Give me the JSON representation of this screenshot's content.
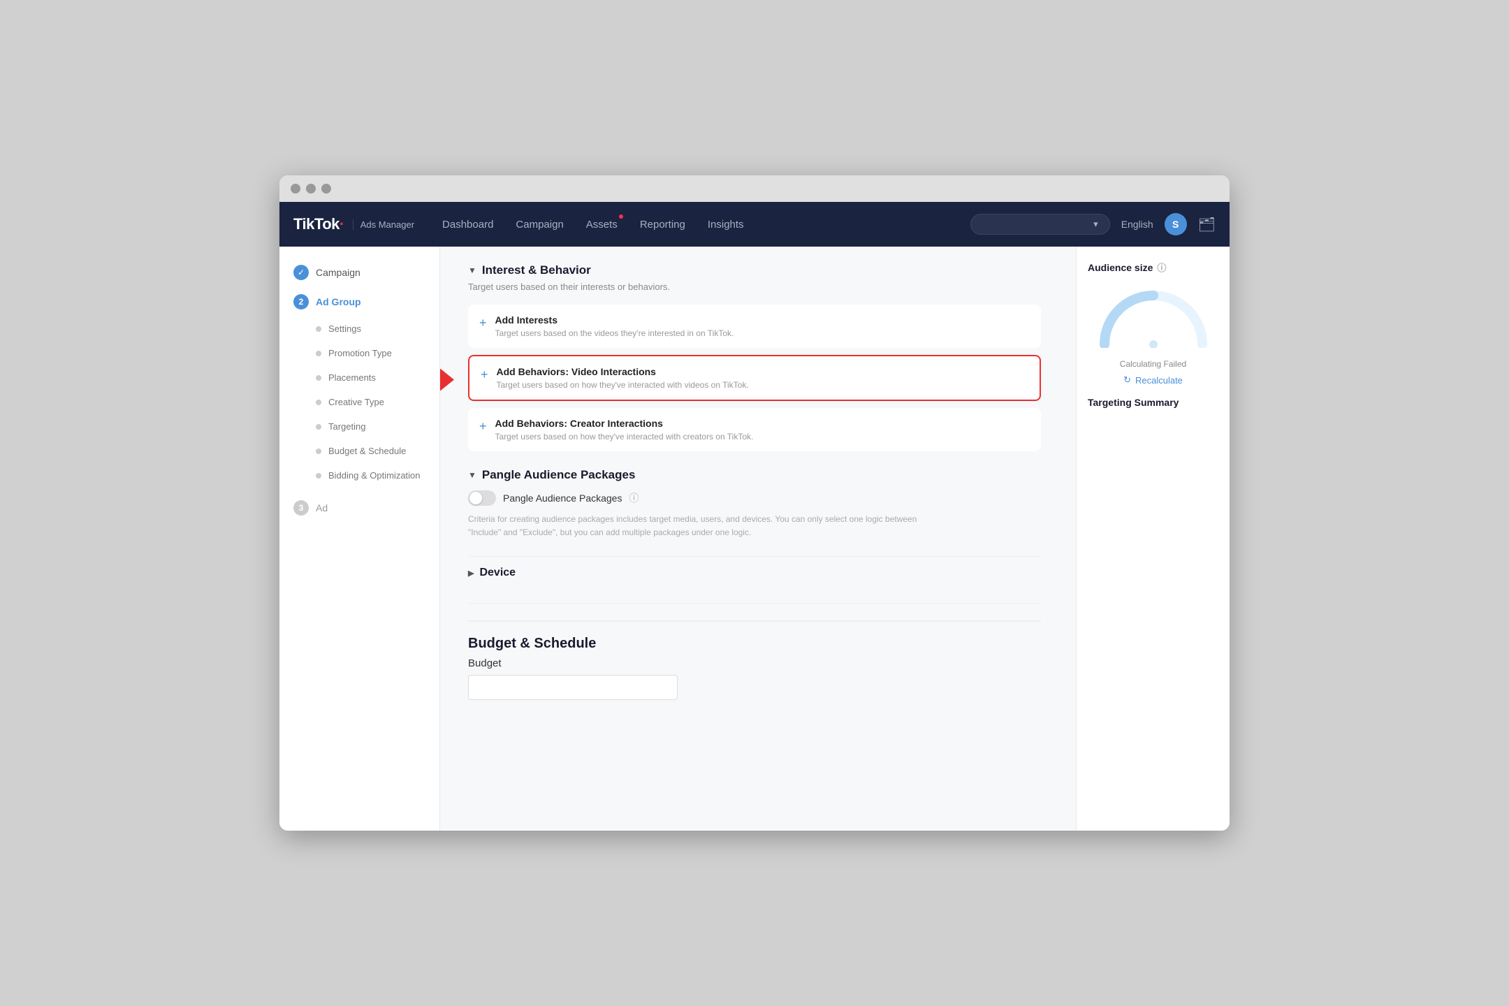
{
  "browser": {
    "title": "TikTok Ads Manager"
  },
  "topnav": {
    "logo": "TikTok",
    "logo_dot": "·",
    "logo_subtitle": "Ads Manager",
    "links": [
      {
        "label": "Dashboard",
        "has_dot": false
      },
      {
        "label": "Campaign",
        "has_dot": false
      },
      {
        "label": "Assets",
        "has_dot": true
      },
      {
        "label": "Reporting",
        "has_dot": false
      },
      {
        "label": "Insights",
        "has_dot": false
      }
    ],
    "lang": "English",
    "avatar_letter": "S"
  },
  "sidebar": {
    "items": [
      {
        "label": "Campaign",
        "type": "check",
        "step": "1"
      },
      {
        "label": "Ad Group",
        "type": "step",
        "step": "2",
        "active": true
      },
      {
        "label": "Settings",
        "type": "sub"
      },
      {
        "label": "Promotion Type",
        "type": "sub"
      },
      {
        "label": "Placements",
        "type": "sub"
      },
      {
        "label": "Creative Type",
        "type": "sub"
      },
      {
        "label": "Targeting",
        "type": "sub"
      },
      {
        "label": "Budget & Schedule",
        "type": "sub"
      },
      {
        "label": "Bidding & Optimization",
        "type": "sub"
      },
      {
        "label": "Ad",
        "type": "step",
        "step": "3"
      }
    ]
  },
  "content": {
    "interest_behavior": {
      "title": "Interest & Behavior",
      "description": "Target users based on their interests or behaviors.",
      "add_interests": {
        "title": "Add Interests",
        "desc": "Target users based on the videos they're interested in on TikTok."
      },
      "add_behaviors_video": {
        "title": "Add Behaviors: Video Interactions",
        "desc": "Target users based on how they've interacted with videos on TikTok."
      },
      "add_behaviors_creator": {
        "title": "Add Behaviors: Creator Interactions",
        "desc": "Target users based on how they've interacted with creators on TikTok."
      }
    },
    "pangle": {
      "title": "Pangle Audience Packages",
      "toggle_label": "Pangle Audience Packages",
      "description": "Criteria for creating audience packages includes target media, users, and devices. You can only select one logic between \"Include\" and \"Exclude\", but you can add multiple packages under one logic."
    },
    "device": {
      "title": "Device"
    },
    "budget": {
      "title": "Budget & Schedule",
      "budget_label": "Budget"
    }
  },
  "right_panel": {
    "audience_size_title": "Audience size",
    "calc_failed": "Calculating Failed",
    "recalculate": "Recalculate",
    "targeting_summary": "Targeting Summary"
  }
}
